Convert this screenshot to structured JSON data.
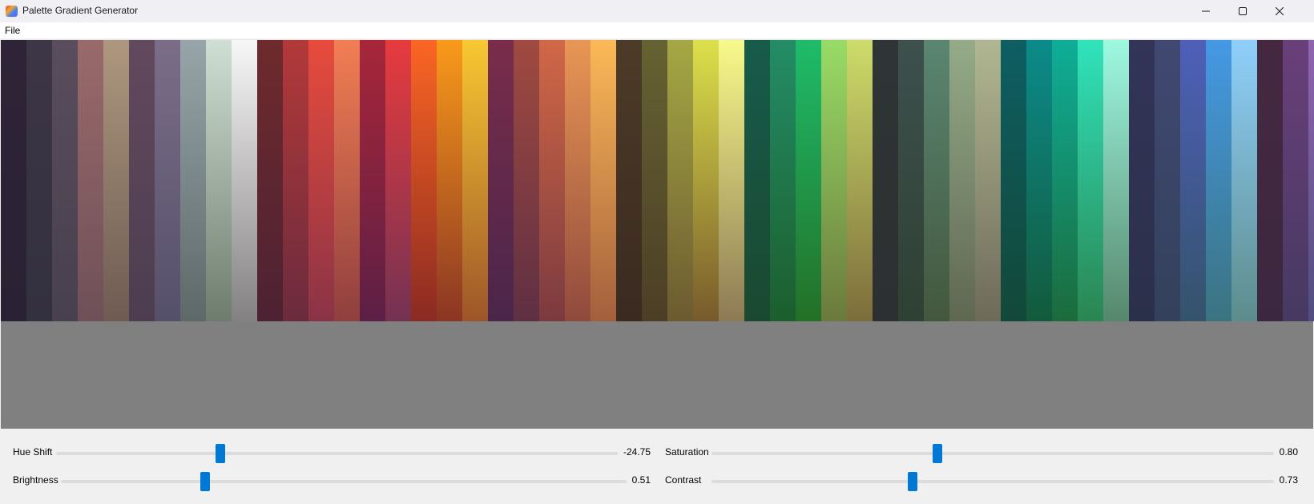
{
  "window": {
    "title": "Palette Gradient Generator",
    "minimize_icon": "minimize-icon",
    "maximize_icon": "maximize-icon",
    "close_icon": "close-icon"
  },
  "menu": {
    "file_label": "File"
  },
  "palette": {
    "background_color": "#808080",
    "swatches": [
      {
        "top": "#2f2437",
        "bottom": "#2a2134"
      },
      {
        "top": "#3c3646",
        "bottom": "#33303f"
      },
      {
        "top": "#5a4d5d",
        "bottom": "#47404e"
      },
      {
        "top": "#9a6a6b",
        "bottom": "#6e5058"
      },
      {
        "top": "#ad977e",
        "bottom": "#6e5b52"
      },
      {
        "top": "#62495e",
        "bottom": "#4d3d50"
      },
      {
        "top": "#7b6d88",
        "bottom": "#55506a"
      },
      {
        "top": "#97a5aa",
        "bottom": "#5d6868"
      },
      {
        "top": "#cfdfd3",
        "bottom": "#6e7c6d"
      },
      {
        "top": "#f7f7f7",
        "bottom": "#828282"
      },
      {
        "top": "#6e2a2d",
        "bottom": "#4d2233"
      },
      {
        "top": "#b33939",
        "bottom": "#6a2b3d"
      },
      {
        "top": "#e84b3c",
        "bottom": "#8a3346"
      },
      {
        "top": "#f27e54",
        "bottom": "#8f3f3e"
      },
      {
        "top": "#a82639",
        "bottom": "#5c1f45"
      },
      {
        "top": "#e73b3d",
        "bottom": "#743253"
      },
      {
        "top": "#fb6623",
        "bottom": "#8a2a22"
      },
      {
        "top": "#f99a1a",
        "bottom": "#8b3524"
      },
      {
        "top": "#f8c932",
        "bottom": "#9d5528"
      },
      {
        "top": "#7a2c4a",
        "bottom": "#4a264b"
      },
      {
        "top": "#a04a40",
        "bottom": "#5f2f43"
      },
      {
        "top": "#d16846",
        "bottom": "#7b3a40"
      },
      {
        "top": "#e99655",
        "bottom": "#904a3c"
      },
      {
        "top": "#fcb957",
        "bottom": "#a35f3c"
      },
      {
        "top": "#4c3b28",
        "bottom": "#3a2a20"
      },
      {
        "top": "#656232",
        "bottom": "#4c3e26"
      },
      {
        "top": "#a5a844",
        "bottom": "#6c5a30"
      },
      {
        "top": "#dde04a",
        "bottom": "#775a2c"
      },
      {
        "top": "#f8fa8a",
        "bottom": "#8d7a55"
      },
      {
        "top": "#175b4b",
        "bottom": "#1a4930"
      },
      {
        "top": "#238d67",
        "bottom": "#1c5e2d"
      },
      {
        "top": "#1ebc6a",
        "bottom": "#237027"
      },
      {
        "top": "#98dc66",
        "bottom": "#6b7a3d"
      },
      {
        "top": "#cddc6a",
        "bottom": "#7c6d3b"
      },
      {
        "top": "#2f3436",
        "bottom": "#2d3030"
      },
      {
        "top": "#3d504d",
        "bottom": "#2f4034"
      },
      {
        "top": "#5a8671",
        "bottom": "#43573e"
      },
      {
        "top": "#95ab88",
        "bottom": "#5f6752"
      },
      {
        "top": "#b1b791",
        "bottom": "#6d6a59"
      },
      {
        "top": "#0e5e63",
        "bottom": "#124838"
      },
      {
        "top": "#0b8b8b",
        "bottom": "#135a3c"
      },
      {
        "top": "#0eae98",
        "bottom": "#1b6b3c"
      },
      {
        "top": "#30e3bb",
        "bottom": "#2a8552"
      },
      {
        "top": "#9ef9e1",
        "bottom": "#56876c"
      },
      {
        "top": "#333458",
        "bottom": "#2b304a"
      },
      {
        "top": "#414872",
        "bottom": "#33415b"
      },
      {
        "top": "#4f5fb9",
        "bottom": "#34536b"
      },
      {
        "top": "#4499e5",
        "bottom": "#3b7380"
      },
      {
        "top": "#8fcffb",
        "bottom": "#5c8c8b"
      },
      {
        "top": "#452840",
        "bottom": "#3b2840"
      },
      {
        "top": "#6a3f7a",
        "bottom": "#463962"
      },
      {
        "top": "#9065b0",
        "bottom": "#504e80"
      }
    ]
  },
  "controls": {
    "hue_shift": {
      "label": "Hue Shift",
      "value_text": "-24.75",
      "fraction": 0.293
    },
    "saturation": {
      "label": "Saturation",
      "value_text": "0.80",
      "fraction": 0.402
    },
    "brightness": {
      "label": "Brightness",
      "value_text": "0.51",
      "fraction": 0.255
    },
    "contrast": {
      "label": "Contrast",
      "value_text": "0.73",
      "fraction": 0.358
    },
    "accent_color": "#0078d4"
  }
}
